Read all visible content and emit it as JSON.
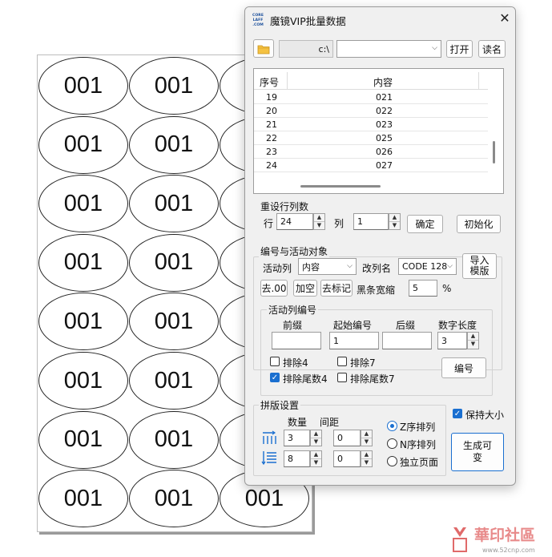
{
  "sheet": {
    "label_text": "001",
    "rows": 8,
    "cols": 3
  },
  "dialog": {
    "logo_text": "CORE LAFF .COM",
    "title": "魔镜VIP批量数据",
    "path_value": "c:\\",
    "file_combo_value": "",
    "open_label": "打开",
    "read_label": "读名",
    "table": {
      "headers": [
        "序号",
        "内容"
      ],
      "rows": [
        [
          "19",
          "021"
        ],
        [
          "20",
          "022"
        ],
        [
          "21",
          "023"
        ],
        [
          "22",
          "025"
        ],
        [
          "23",
          "026"
        ],
        [
          "24",
          "027"
        ]
      ]
    },
    "reset": {
      "title": "重设行列数",
      "row_label": "行",
      "row_value": "24",
      "col_label": "列",
      "col_value": "1",
      "confirm_label": "确定",
      "init_label": "初始化"
    },
    "numbering": {
      "title": "编号与活动对象",
      "active_col_label": "活动列",
      "active_col_value": "内容",
      "rename_label": "改列名",
      "barcode_value": "CODE 128",
      "import_label": "导入模版",
      "remove00_label": "去.00",
      "add_space_label": "加空",
      "remove_mark_label": "去标记",
      "bar_shrink_label": "黑条宽缩",
      "bar_shrink_value": "5",
      "percent": "%"
    },
    "active_numbering": {
      "title": "活动列编号",
      "prefix_label": "前缀",
      "prefix_value": "",
      "start_label": "起始编号",
      "start_value": "1",
      "suffix_label": "后缀",
      "suffix_value": "",
      "digits_label": "数字长度",
      "digits_value": "3",
      "exclude4_label": "排除4",
      "exclude4_checked": false,
      "exclude7_label": "排除7",
      "exclude7_checked": false,
      "exclude_tail4_label": "排除尾数4",
      "exclude_tail4_checked": true,
      "exclude_tail7_label": "排除尾数7",
      "exclude_tail7_checked": false,
      "number_button_label": "编号"
    },
    "layout": {
      "title": "拼版设置",
      "count_label": "数量",
      "spacing_label": "间距",
      "h_count": "3",
      "h_spacing": "0",
      "v_count": "8",
      "v_spacing": "0",
      "z_order_label": "Z序排列",
      "n_order_label": "N序排列",
      "independent_label": "独立页面",
      "selected_order": "Z序排列",
      "keep_size_label": "保持大小",
      "keep_size_checked": true,
      "generate_label": "生成可变"
    },
    "accent_color": "#1a6fd0"
  },
  "watermark": {
    "text": "華印社區",
    "url": "www.52cnp.com"
  }
}
